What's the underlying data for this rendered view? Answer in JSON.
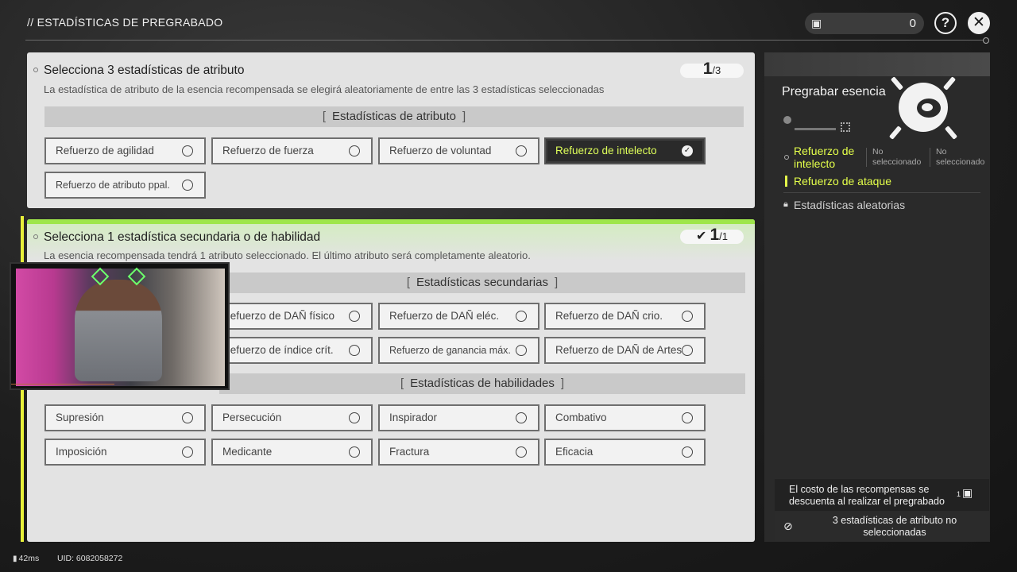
{
  "header": {
    "title": "// ESTADÍSTICAS DE PREGRABADO",
    "currency_value": "0",
    "help_label": "?",
    "close_label": "✕"
  },
  "attribute_panel": {
    "title": "Selecciona 3 estadísticas de atributo",
    "description": "La estadística de atributo de la esencia recompensada se elegirá aleatoriamente de entre las 3 estadísticas seleccionadas",
    "counter_current": "1",
    "counter_total": "/3",
    "section_label": "Estadísticas de atributo",
    "options": [
      {
        "label": "Refuerzo de agilidad",
        "selected": false
      },
      {
        "label": "Refuerzo de fuerza",
        "selected": false
      },
      {
        "label": "Refuerzo de voluntad",
        "selected": false
      },
      {
        "label": "Refuerzo de intelecto",
        "selected": true
      },
      {
        "label": "Refuerzo de atributo ppal.",
        "selected": false
      }
    ]
  },
  "secondary_panel": {
    "title": "Selecciona 1 estadística secundaria o de habilidad",
    "description": "La esencia recompensada tendrá 1 atributo seleccionado. El último atributo será completamente aleatorio.",
    "counter_current": "1",
    "counter_total": "/1",
    "secondary_section_label": "Estadísticas secundarias",
    "secondary_options": [
      {
        "label": "Refuerzo de DAÑ físico"
      },
      {
        "label": "Refuerzo de DAÑ eléc."
      },
      {
        "label": "Refuerzo de DAÑ crio."
      },
      {
        "label": "Refuerzo de índice crít."
      },
      {
        "label": "Refuerzo de ganancia máx."
      },
      {
        "label": "Refuerzo de DAÑ de Artes"
      }
    ],
    "skill_section_label": "Estadísticas de habilidades",
    "skill_options": [
      {
        "label": "Supresión"
      },
      {
        "label": "Persecución"
      },
      {
        "label": "Inspirador"
      },
      {
        "label": "Combativo"
      },
      {
        "label": "Imposición"
      },
      {
        "label": "Medicante"
      },
      {
        "label": "Fractura"
      },
      {
        "label": "Eficacia"
      }
    ]
  },
  "side_panel": {
    "title": "Pregrabar esencia",
    "slot_selected": "Refuerzo de intelecto",
    "slot_empty_1": "No seleccionado",
    "slot_empty_2": "No seleccionado",
    "secondary_selected": "Refuerzo de ataque",
    "random_label": "Estadísticas aleatorias",
    "cost_text": "El costo de las recompensas se descuenta al realizar el pregrabado",
    "cost_amount": "1",
    "warning_text": "3 estadísticas de atributo no seleccionadas"
  },
  "footer": {
    "ping": "42ms",
    "uid": "UID: 6082058272"
  },
  "colors": {
    "accent_yellow": "#e4ff4a",
    "accent_green": "#9ee64a",
    "panel_bg": "#e3e3e3",
    "selected_bg": "#2a2a2a"
  }
}
